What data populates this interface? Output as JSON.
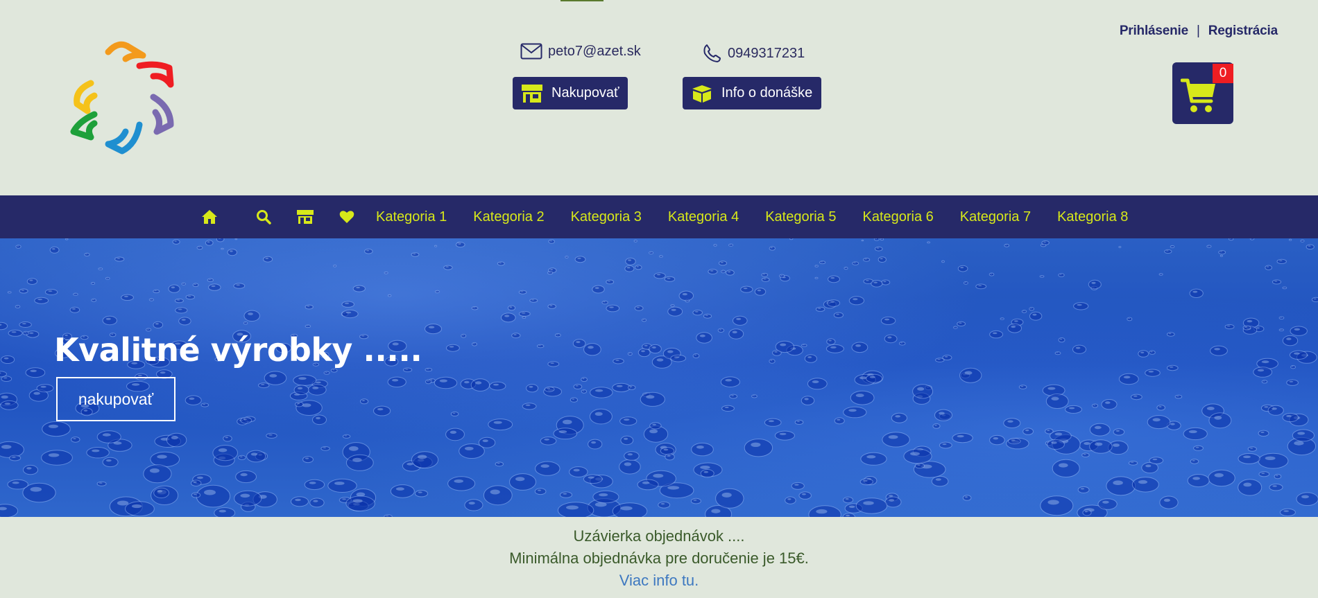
{
  "header": {
    "email": "peto7@azet.sk",
    "phone": "0949317231",
    "shop_button": "Nakupovať",
    "delivery_button": "Info o donáške",
    "login": "Prihlásenie",
    "separator": "|",
    "register": "Registrácia",
    "cart_count": "0"
  },
  "nav": {
    "items": [
      "Kategoria 1",
      "Kategoria 2",
      "Kategoria 3",
      "Kategoria 4",
      "Kategoria 5",
      "Kategoria 6",
      "Kategoria 7",
      "Kategoria 8"
    ]
  },
  "hero": {
    "title": "Kvalitné výrobky .....",
    "button": "nakupovať"
  },
  "notice": {
    "line1": "Uzávierka objednávok ....",
    "line2": "Minimálna objednávka pre doručenie je 15€.",
    "link": "Viac info tu."
  },
  "colors": {
    "background": "#e0e7dc",
    "navy": "#262968",
    "accent_yellow": "#d7e81a",
    "badge_red": "#ef1d22",
    "link_blue": "#3d78c0"
  },
  "icons": [
    "envelope-icon",
    "phone-icon",
    "store-icon",
    "box-icon",
    "cart-icon",
    "home-icon",
    "search-icon",
    "heart-icon"
  ]
}
